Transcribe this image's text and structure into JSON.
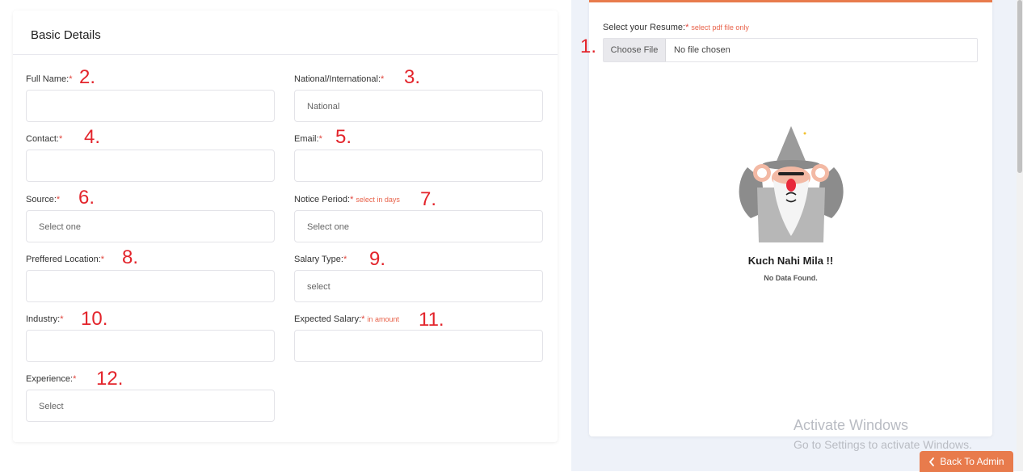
{
  "basic_details": {
    "title": "Basic Details",
    "fields": [
      {
        "label": "Full Name:",
        "required": "*",
        "hint": "",
        "value": "",
        "annotation": "2."
      },
      {
        "label": "National/International:",
        "required": "*",
        "hint": "",
        "value": "National",
        "annotation": "3."
      },
      {
        "label": "Contact:",
        "required": "*",
        "hint": "",
        "value": "",
        "annotation": "4."
      },
      {
        "label": "Email:",
        "required": "*",
        "hint": "",
        "value": "",
        "annotation": "5."
      },
      {
        "label": "Source:",
        "required": "*",
        "hint": "",
        "value": "Select one",
        "annotation": "6."
      },
      {
        "label": "Notice Period:",
        "required": "*",
        "hint": "select in days",
        "value": "Select one",
        "annotation": "7."
      },
      {
        "label": "Preffered Location:",
        "required": "*",
        "hint": "",
        "value": "",
        "annotation": "8."
      },
      {
        "label": "Salary Type:",
        "required": "*",
        "hint": "",
        "value": "select",
        "annotation": "9."
      },
      {
        "label": "Industry:",
        "required": "*",
        "hint": "",
        "value": "",
        "annotation": "10."
      },
      {
        "label": "Expected Salary:",
        "required": "*",
        "hint": "in amount",
        "value": "",
        "annotation": "11."
      },
      {
        "label": "Experience:",
        "required": "*",
        "hint": "",
        "value": "Select",
        "annotation": "12."
      }
    ]
  },
  "resume": {
    "label": "Select your Resume:",
    "required": "*",
    "hint": "select pdf file only",
    "annotation": "1.",
    "choose_button": "Choose File",
    "file_status": "No file chosen",
    "empty_title": "Kuch Nahi Mila !!",
    "empty_subtitle": "No Data Found.",
    "illustration": "wizard-illustration"
  },
  "watermark": {
    "line1": "Activate Windows",
    "line2": "Go to Settings to activate Windows."
  },
  "back_button": {
    "label": "Back To Admin",
    "icon": "chevron-left-icon"
  },
  "colors": {
    "accent": "#e87b4c",
    "required": "#e0443b",
    "annotation": "#e3242b",
    "right_panel_bg": "#eef2f9"
  }
}
